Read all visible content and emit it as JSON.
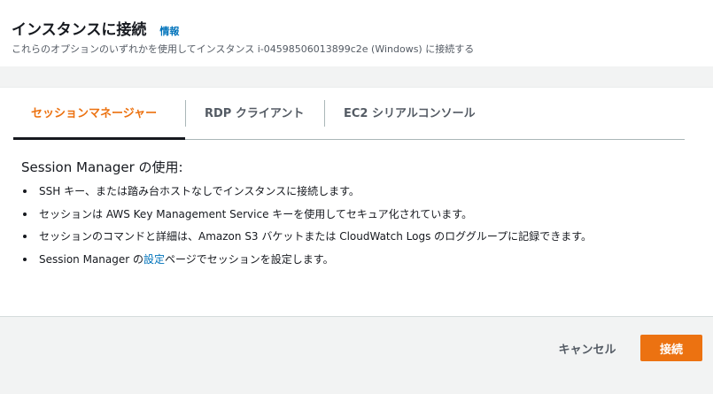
{
  "header": {
    "title": "インスタンスに接続",
    "info_link": "情報",
    "subtitle": "これらのオプションのいずれかを使用してインスタンス i-04598506013899c2e (Windows) に接続する"
  },
  "tabs": [
    {
      "label": "セッションマネージャー",
      "active": true
    },
    {
      "label": "RDP クライアント",
      "active": false
    },
    {
      "label": "EC2 シリアルコンソール",
      "active": false
    }
  ],
  "content": {
    "heading": "Session Manager の使用:",
    "bullets": [
      "SSH キー、または踏み台ホストなしでインスタンスに接続します。",
      "セッションは AWS Key Management Service キーを使用してセキュア化されています。",
      "セッションのコマンドと詳細は、Amazon S3 バケットまたは CloudWatch Logs のロググループに記録できます。"
    ],
    "bullet4": {
      "prefix": "Session Manager の",
      "link": "設定",
      "suffix": "ページでセッションを設定します。"
    }
  },
  "footer": {
    "cancel_label": "キャンセル",
    "connect_label": "接続"
  },
  "colors": {
    "accent": "#ec7211",
    "link": "#0073bb",
    "background": "#f2f3f3"
  }
}
